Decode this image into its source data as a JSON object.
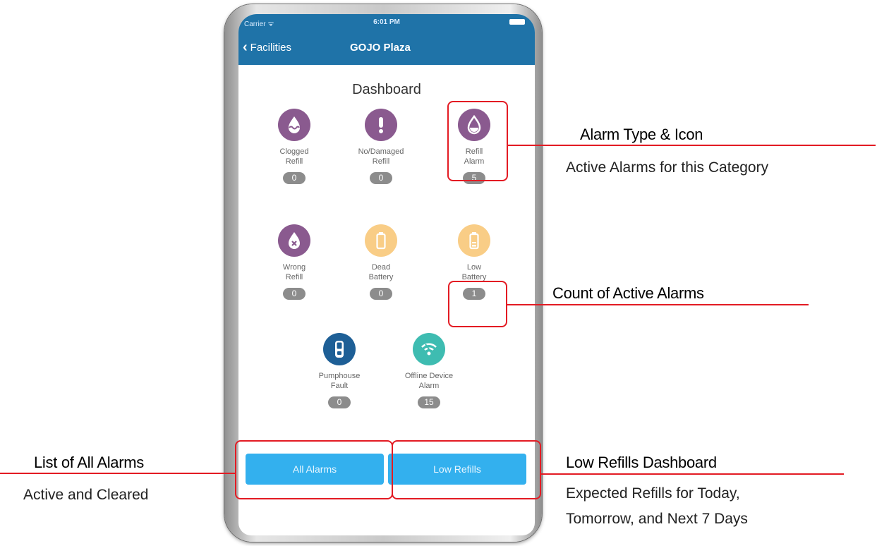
{
  "status_bar": {
    "carrier": "Carrier ᯤ",
    "time": "6:01 PM"
  },
  "nav": {
    "back_label": "Facilities",
    "title": "GOJO Plaza"
  },
  "dashboard_title": "Dashboard",
  "tiles": [
    {
      "label": "Clogged\nRefill",
      "count": "0",
      "icon": "clogged-refill-icon",
      "color": "#8a5a8f"
    },
    {
      "label": "No/Damaged\nRefill",
      "count": "0",
      "icon": "exclamation-icon",
      "color": "#8a5a8f"
    },
    {
      "label": "Refill\nAlarm",
      "count": "5",
      "icon": "refill-drop-icon",
      "color": "#8a5a8f"
    },
    {
      "label": "Wrong\nRefill",
      "count": "0",
      "icon": "wrong-refill-icon",
      "color": "#8a5a8f"
    },
    {
      "label": "Dead\nBattery",
      "count": "0",
      "icon": "dead-battery-icon",
      "color": "#f9cd86"
    },
    {
      "label": "Low\nBattery",
      "count": "1",
      "icon": "low-battery-icon",
      "color": "#f9cd86"
    },
    {
      "label": "Pumphouse\nFault",
      "count": "0",
      "icon": "pumphouse-icon",
      "color": "#1e5f96"
    },
    {
      "label": "Offline Device\nAlarm",
      "count": "15",
      "icon": "offline-wifi-icon",
      "color": "#3ebcb1"
    }
  ],
  "buttons": {
    "all_alarms": "All Alarms",
    "low_refills": "Low Refills"
  },
  "callouts": {
    "alarm_type": {
      "title": "Alarm Type & Icon",
      "subtitle": "Active Alarms for this Category"
    },
    "count": {
      "title": "Count of Active Alarms"
    },
    "all_alarms": {
      "title": "List of All Alarms",
      "subtitle": "Active and Cleared"
    },
    "low_refills": {
      "title": "Low Refills Dashboard",
      "subtitle_line1": "Expected Refills for Today,",
      "subtitle_line2": "Tomorrow, and Next 7 Days"
    }
  },
  "colors": {
    "nav_bar": "#1f73a8",
    "button": "#33b0ee",
    "callout_red": "#e31b23",
    "badge": "#8c8c8c"
  }
}
